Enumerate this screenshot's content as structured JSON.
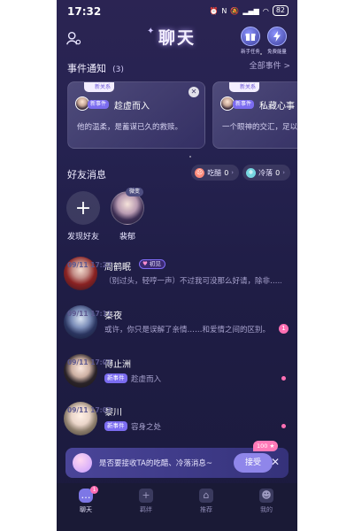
{
  "status_bar": {
    "time": "17:32",
    "battery": "82"
  },
  "header": {
    "title": "聊天",
    "right_buttons": [
      {
        "label": "新手任务",
        "icon": "gift-icon"
      },
      {
        "label": "免费能量",
        "icon": "lightning-icon"
      }
    ]
  },
  "events": {
    "title": "事件通知",
    "count": "(3)",
    "view_all": "全部事件 >",
    "cards": [
      {
        "tag": "新关系",
        "new_label": "新事件",
        "name": "趁虚而入",
        "desc": "他的温柔，是蓄谋已久的救赎。"
      },
      {
        "tag": "新关系",
        "new_label": "新事件",
        "name": "私藏心事",
        "desc": "一个眼神的交汇，足以让伪装瞬间瓦解。"
      }
    ]
  },
  "friends": {
    "title": "好友消息",
    "pills": [
      {
        "label": "吃醋",
        "count": "0"
      },
      {
        "label": "冷落",
        "count": "0"
      }
    ],
    "add_label": "发现好友",
    "featured_label": "裴郁",
    "featured_badge": "微变"
  },
  "chats": [
    {
      "name": "周鹤眠",
      "badge": "初见",
      "time": "09/11 17:27",
      "msg": "（别过头，轻哼一声）不过我可没那么好请，除非……",
      "unread": ""
    },
    {
      "name": "秦夜",
      "time": "09/11 17:11",
      "msg": "或许，你只是误解了亲情……和爱情之间的区别。",
      "unread": "1"
    },
    {
      "name": "傅止洲",
      "time": "09/11 17:07",
      "new_label": "新事件",
      "event": "趁虚而入"
    },
    {
      "name": "黎川",
      "time": "09/11 17:07",
      "new_label": "新事件",
      "event": "容身之处"
    }
  ],
  "banner": {
    "text": "是否要接收TA的吃醋、冷落消息~",
    "accept": "接受",
    "reward": "100 ★",
    "close": "✕"
  },
  "tabs": [
    {
      "label": "聊天",
      "icon": "chat-icon",
      "badge": "1"
    },
    {
      "label": "羁绊",
      "icon": "bond-icon"
    },
    {
      "label": "推荐",
      "icon": "recommend-icon"
    },
    {
      "label": "我的",
      "icon": "profile-icon"
    }
  ],
  "colors": {
    "accent": "#7d77e6",
    "unread": "#ff6fb3",
    "background": "#252250"
  }
}
